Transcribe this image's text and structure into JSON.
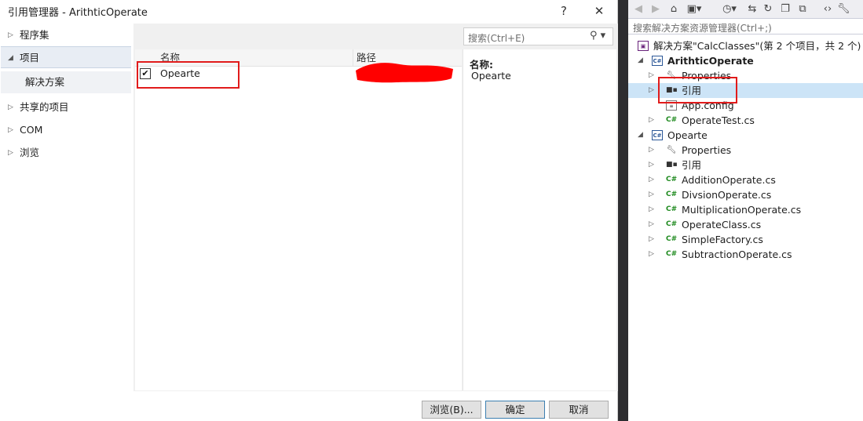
{
  "dialog": {
    "title": "引用管理器 - ArithticOperate",
    "help_label": "?",
    "close_label": "✕"
  },
  "left_nav": {
    "items": [
      {
        "label": "程序集",
        "expanded": false
      },
      {
        "label": "项目",
        "expanded": true
      },
      {
        "label": "解决方案",
        "sub": true
      },
      {
        "label": "共享的项目",
        "expanded": false
      },
      {
        "label": "COM",
        "expanded": false
      },
      {
        "label": "浏览",
        "expanded": false
      }
    ]
  },
  "search": {
    "placeholder": "搜索(Ctrl+E)",
    "icon": "search-icon"
  },
  "grid": {
    "columns": [
      "名称",
      "路径"
    ],
    "rows": [
      {
        "checked": true,
        "check_glyph": "✔",
        "name": "Opearte",
        "path": ""
      }
    ]
  },
  "detail": {
    "label": "名称:",
    "value": "Opearte"
  },
  "footer": {
    "browse_label": "浏览(B)...",
    "ok_label": "确定",
    "cancel_label": "取消"
  },
  "solution_explorer": {
    "search_placeholder": "搜索解决方案资源管理器(Ctrl+;)",
    "solution_label": "解决方案\"CalcClasses\"(第 2 个项目，共 2 个)",
    "projects": [
      {
        "name": "ArithticOperate",
        "items": [
          "Properties",
          "引用",
          "App.config",
          "OperateTest.cs"
        ]
      },
      {
        "name": "Opearte",
        "items": [
          "Properties",
          "引用",
          "AdditionOperate.cs",
          "DivsionOperate.cs",
          "MultiplicationOperate.cs",
          "OperateClass.cs",
          "SimpleFactory.cs",
          "SubtractionOperate.cs"
        ]
      }
    ]
  },
  "colors": {
    "accent": "#3c7fb1",
    "highlight": "#cce4f7",
    "annotation": "#e11b1b",
    "divider": "#2d2d30"
  }
}
